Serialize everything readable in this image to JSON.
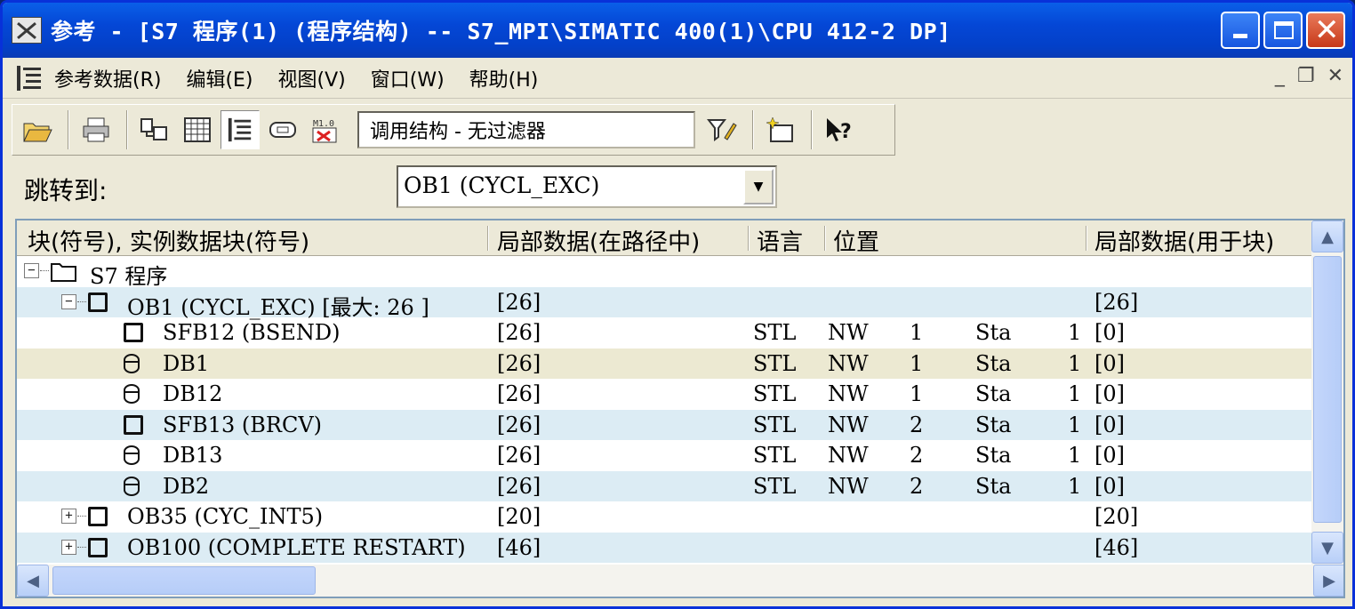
{
  "window": {
    "title": "参考 - [S7 程序(1) (程序结构) -- S7_MPI\\SIMATIC 400(1)\\CPU 412-2 DP]"
  },
  "menu": {
    "items": [
      "参考数据(R)",
      "编辑(E)",
      "视图(V)",
      "窗口(W)",
      "帮助(H)"
    ]
  },
  "toolbar": {
    "filter_value": "调用结构 - 无过滤器",
    "icons": [
      "open-icon",
      "print-icon",
      "cross-ref-icon",
      "list-icon",
      "call-structure-icon",
      "dependency-icon",
      "unused-symbols-icon",
      "filter-icon",
      "new-window-icon",
      "help-icon"
    ]
  },
  "jump": {
    "label": "跳转到:",
    "value": "OB1 (CYCL_EXC)"
  },
  "table": {
    "headers": [
      "块(符号), 实例数据块(符号)",
      "局部数据(在路径中)",
      "语言",
      "位置",
      "局部数据(用于块)"
    ],
    "rows": [
      {
        "level": 0,
        "expander": "⊟",
        "icon": "folder-icon",
        "name": "S7 程序",
        "local": "",
        "lang": "",
        "loc1": "",
        "loc2": "",
        "loc3": "",
        "loc4": "",
        "block": "",
        "bg": "white"
      },
      {
        "level": 1,
        "expander": "⊟",
        "icon": "block-icon",
        "name": "OB1 (CYCL_EXC) [最大: 26 ]",
        "local": "[26]",
        "lang": "",
        "loc1": "",
        "loc2": "",
        "loc3": "",
        "loc4": "",
        "block": "[26]",
        "bg": "blue"
      },
      {
        "level": 2,
        "expander": "",
        "icon": "block-icon",
        "name": "SFB12 (BSEND)",
        "local": "[26]",
        "lang": "STL",
        "loc1": "NW",
        "loc2": "1",
        "loc3": "Sta",
        "loc4": "1",
        "block": "[0]",
        "bg": "white"
      },
      {
        "level": 2,
        "expander": "",
        "icon": "db-icon",
        "name": "DB1",
        "local": "[26]",
        "lang": "STL",
        "loc1": "NW",
        "loc2": "1",
        "loc3": "Sta",
        "loc4": "1",
        "block": "[0]",
        "bg": "tan"
      },
      {
        "level": 2,
        "expander": "",
        "icon": "db-icon",
        "name": "DB12",
        "local": "[26]",
        "lang": "STL",
        "loc1": "NW",
        "loc2": "1",
        "loc3": "Sta",
        "loc4": "1",
        "block": "[0]",
        "bg": "white"
      },
      {
        "level": 2,
        "expander": "",
        "icon": "block-icon",
        "name": "SFB13 (BRCV)",
        "local": "[26]",
        "lang": "STL",
        "loc1": "NW",
        "loc2": "2",
        "loc3": "Sta",
        "loc4": "1",
        "block": "[0]",
        "bg": "blue"
      },
      {
        "level": 2,
        "expander": "",
        "icon": "db-icon",
        "name": "DB13",
        "local": "[26]",
        "lang": "STL",
        "loc1": "NW",
        "loc2": "2",
        "loc3": "Sta",
        "loc4": "1",
        "block": "[0]",
        "bg": "white"
      },
      {
        "level": 2,
        "expander": "",
        "icon": "db-icon",
        "name": "DB2",
        "local": "[26]",
        "lang": "STL",
        "loc1": "NW",
        "loc2": "2",
        "loc3": "Sta",
        "loc4": "1",
        "block": "[0]",
        "bg": "blue"
      },
      {
        "level": 1,
        "expander": "⊞",
        "icon": "block-icon",
        "name": "OB35 (CYC_INT5)",
        "local": "[20]",
        "lang": "",
        "loc1": "",
        "loc2": "",
        "loc3": "",
        "loc4": "",
        "block": "[20]",
        "bg": "white"
      },
      {
        "level": 1,
        "expander": "⊞",
        "icon": "block-icon",
        "name": "OB100 (COMPLETE RESTART)",
        "local": "[46]",
        "lang": "",
        "loc1": "",
        "loc2": "",
        "loc3": "",
        "loc4": "",
        "block": "[46]",
        "bg": "blue"
      }
    ]
  }
}
